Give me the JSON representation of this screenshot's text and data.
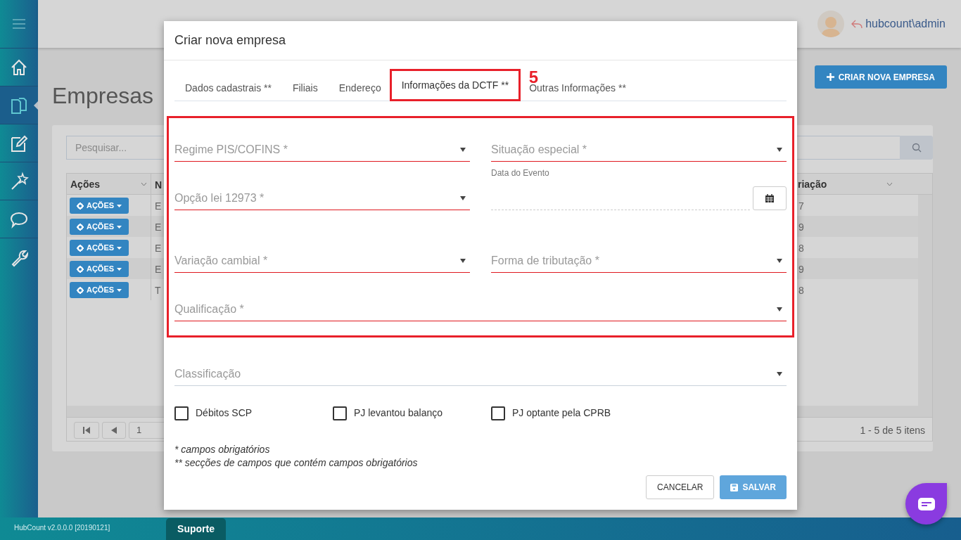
{
  "sidebar": {
    "items": [
      {
        "kind": "home",
        "selected": false
      },
      {
        "kind": "documents",
        "selected": true
      },
      {
        "kind": "edit",
        "selected": false
      },
      {
        "kind": "wand",
        "selected": false
      },
      {
        "kind": "chat",
        "selected": false
      },
      {
        "kind": "wrench",
        "selected": false
      }
    ]
  },
  "header": {
    "user": "hubcount\\admin"
  },
  "page": {
    "title": "Empresas",
    "create_button": "CRIAR NOVA EMPRESA",
    "search": {
      "placeholder": "Pesquisar..."
    },
    "table": {
      "columns": [
        "Ações",
        "N",
        "riação"
      ],
      "rows": [
        {
          "action": "AÇÕES",
          "column_2": "E",
          "column_3": "7"
        },
        {
          "action": "AÇÕES",
          "column_2": "E",
          "column_3": "9"
        },
        {
          "action": "AÇÕES",
          "column_2": "E",
          "column_3": "8"
        },
        {
          "action": "AÇÕES",
          "column_2": "E",
          "column_3": "9"
        },
        {
          "action": "AÇÕES",
          "column_2": "T",
          "column_3": "8"
        }
      ]
    },
    "pager": {
      "page": "1",
      "summary": "1 - 5 de 5 itens"
    }
  },
  "footer": {
    "version": "HubCount v2.0.0.0 [20190121]",
    "support_tab": "Suporte"
  },
  "dialog": {
    "title": "Criar nova empresa",
    "tabs": [
      {
        "label": "Dados cadastrais **",
        "selected": false
      },
      {
        "label": "Filiais",
        "selected": false
      },
      {
        "label": "Endereço",
        "selected": false
      },
      {
        "label": "Informações da DCTF **",
        "selected": true
      },
      {
        "label": "Outras Informações **",
        "selected": false
      }
    ],
    "step_label": "5",
    "rows": [
      {
        "highlighted": true,
        "fields": [
          {
            "kind": "select",
            "label": "Regime PIS/COFINS *",
            "invalid": true
          },
          {
            "kind": "select",
            "label": "Situação especial *",
            "invalid": true
          }
        ]
      },
      {
        "highlighted": true,
        "fields": [
          {
            "kind": "select",
            "label": "Opção lei 12973 *",
            "invalid": true
          },
          {
            "kind": "date",
            "label": "Data do Evento",
            "invalid": false
          }
        ]
      },
      {
        "highlighted": true,
        "fields": [
          {
            "kind": "select",
            "label": "Variação cambial *",
            "invalid": true
          },
          {
            "kind": "select",
            "label": "Forma de tributação *",
            "invalid": true
          }
        ]
      },
      {
        "highlighted": true,
        "fields": [
          {
            "kind": "select",
            "label": "Qualificação *",
            "invalid": true
          }
        ]
      },
      {
        "highlighted": false,
        "fields": [
          {
            "kind": "select",
            "label": "Classificação",
            "invalid": false
          }
        ]
      }
    ],
    "checkboxes": [
      {
        "label": "Débitos SCP",
        "checked": false
      },
      {
        "label": "PJ levantou balanço",
        "checked": false
      },
      {
        "label": "PJ optante pela CPRB",
        "checked": false
      }
    ],
    "notes": [
      "* campos obrigatórios",
      "** secções de campos que contém campos obrigatórios"
    ],
    "buttons": [
      {
        "kind": "secondary",
        "label": "CANCELAR",
        "disabled": false
      },
      {
        "kind": "primary",
        "label": "SALVAR",
        "disabled": true
      }
    ]
  }
}
